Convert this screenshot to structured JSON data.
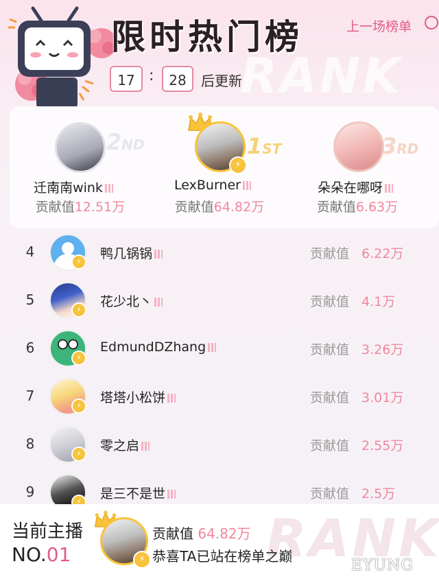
{
  "header": {
    "title": "限时热门榜",
    "background_word": "RANK",
    "prev_link": "上一场榜单",
    "timer": {
      "hours": "17",
      "separator": ":",
      "minutes": "28",
      "suffix": "后更新"
    }
  },
  "podium": [
    {
      "place": "2",
      "place_suffix": "ND",
      "name": "迁南南wink",
      "label": "贡献值",
      "value": "12.51万"
    },
    {
      "place": "1",
      "place_suffix": "ST",
      "name": "LexBurner",
      "label": "贡献值",
      "value": "64.82万"
    },
    {
      "place": "3",
      "place_suffix": "RD",
      "name": "朵朵在哪呀",
      "label": "贡献值",
      "value": "6.63万"
    }
  ],
  "list": [
    {
      "rank": "4",
      "name": "鸭几锅锅",
      "label": "贡献值",
      "value": "6.22万"
    },
    {
      "rank": "5",
      "name": "花少北丶",
      "label": "贡献值",
      "value": "4.1万"
    },
    {
      "rank": "6",
      "name": "EdmundDZhang",
      "label": "贡献值",
      "value": "3.26万"
    },
    {
      "rank": "7",
      "name": "塔塔小松饼",
      "label": "贡献值",
      "value": "3.01万"
    },
    {
      "rank": "8",
      "name": "零之启",
      "label": "贡献值",
      "value": "2.55万"
    },
    {
      "rank": "9",
      "name": "是三不是世",
      "label": "贡献值",
      "value": "2.5万"
    }
  ],
  "footer": {
    "current_label": "当前主播",
    "no_prefix": "NO.",
    "no_value": "01",
    "contrib_label": "贡献值",
    "contrib_value": "64.82万",
    "message": "恭喜TA已站在榜单之巅",
    "background_word": "RANK"
  },
  "watermark": "EYUNG",
  "colors": {
    "accent": "#e25c84",
    "value_pink": "#f0879d",
    "gold": "#f8c23a"
  },
  "icons": [
    "tv-mascot-icon",
    "crown-icon",
    "signal-bars-icon",
    "lightning-badge-icon",
    "refresh-icon"
  ]
}
